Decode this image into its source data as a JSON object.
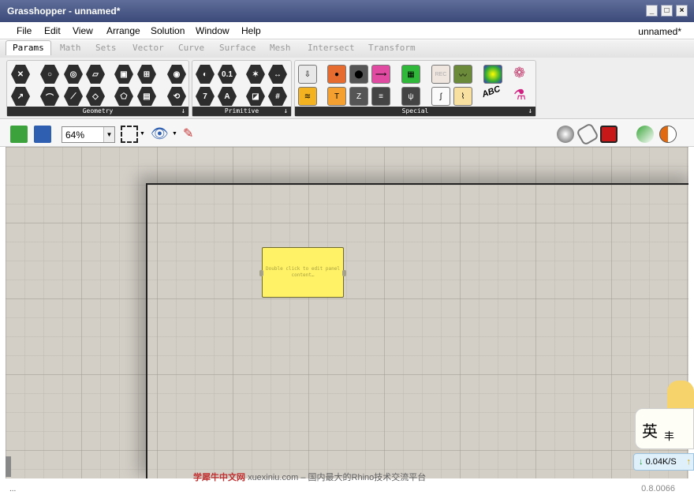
{
  "window": {
    "title": "Grasshopper - unnamed*",
    "doc_name": "unnamed*"
  },
  "menu": [
    "File",
    "Edit",
    "View",
    "Arrange",
    "Solution",
    "Window",
    "Help"
  ],
  "tabs": [
    "Params",
    "Math",
    "Sets",
    "Vector",
    "Curve",
    "Surface",
    "Mesh",
    "Intersect",
    "Transform"
  ],
  "ribbon": {
    "panels": [
      "Geometry",
      "Primitive",
      "Special"
    ],
    "primitive_icons": [
      "0.1",
      "7",
      "A"
    ],
    "special_icons": [
      "REC",
      "ABC"
    ]
  },
  "toolbar": {
    "zoom": "64%"
  },
  "canvas": {
    "panel_text": "Double click to edit panel content…"
  },
  "status": {
    "dots": "...",
    "version": "0.8.0066"
  },
  "watermark": {
    "cn_name": "学犀牛中文网",
    "site": "xuexiniu.com",
    "slogan": "– 国内最大的Rhino技术交流平台"
  },
  "desktop": {
    "ime_char": "英",
    "ime_extra": "丰",
    "net_speed": "0.04K/S"
  },
  "colors": {
    "titlebar": "#4a5a8a",
    "canvas": "#d3cfc7",
    "panel_yellow": "#fff266",
    "ribbon_label": "#2f2f2f"
  }
}
